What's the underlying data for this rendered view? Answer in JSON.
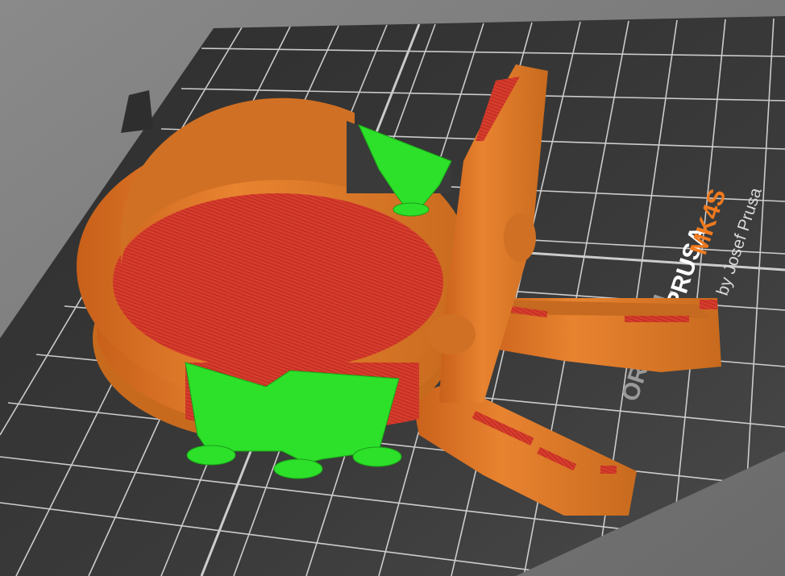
{
  "viewport": {
    "bed": {
      "brand_prefix": "ORIGINAL",
      "brand_name": "PRUSA",
      "model": "MK4S",
      "byline": "by Josef Prusa"
    },
    "colors": {
      "background": "#7a7a7a",
      "bed": "#333333",
      "grid": "#e6e6e6",
      "perimeter": "#e07b28",
      "infill": "#d8402c",
      "support": "#2de02a",
      "brand_accent": "#f07a1e"
    }
  }
}
